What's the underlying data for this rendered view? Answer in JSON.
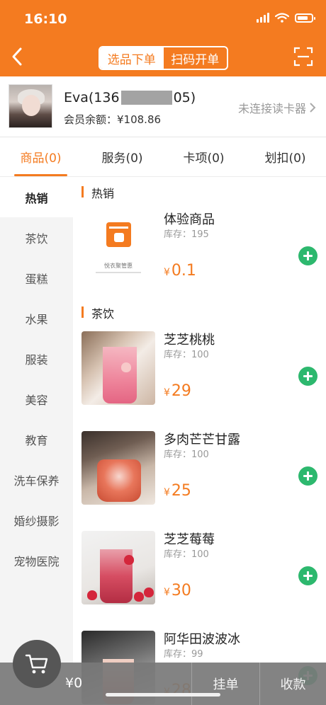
{
  "status_bar": {
    "time": "16:10"
  },
  "header": {
    "segments": [
      {
        "label": "选品下单",
        "active": true
      },
      {
        "label": "扫码开单",
        "active": false
      }
    ],
    "icons": {
      "back": "chevron-left-icon",
      "scan": "scan-icon"
    }
  },
  "member": {
    "name_prefix": "Eva(136",
    "name_suffix": "05)",
    "balance": "会员余额：¥108.86",
    "reader_status": "未连接读卡器"
  },
  "tabs": [
    {
      "label": "商品(0)",
      "active": true
    },
    {
      "label": "服务(0)",
      "active": false
    },
    {
      "label": "卡项(0)",
      "active": false
    },
    {
      "label": "划扣(0)",
      "active": false
    }
  ],
  "categories": [
    "热销",
    "茶饮",
    "蛋糕",
    "水果",
    "服装",
    "美容",
    "教育",
    "洗车保养",
    "婚纱摄影",
    "宠物医院"
  ],
  "sections": [
    {
      "title": "热销",
      "products": [
        {
          "name": "体验商品",
          "stock": "库存：195",
          "currency": "¥",
          "price": "0.1",
          "logo_text": "悦衣聚管惠"
        }
      ]
    },
    {
      "title": "茶饮",
      "products": [
        {
          "name": "芝芝桃桃",
          "stock": "库存：100",
          "currency": "¥",
          "price": "29"
        },
        {
          "name": "多肉芒芒甘露",
          "stock": "库存：100",
          "currency": "¥",
          "price": "25"
        },
        {
          "name": "芝芝莓莓",
          "stock": "库存：100",
          "currency": "¥",
          "price": "30"
        },
        {
          "name": "阿华田波波冰",
          "stock": "库存：99",
          "currency": "¥",
          "price": "28"
        }
      ]
    }
  ],
  "bottom_bar": {
    "total": "¥0",
    "hold_label": "挂单",
    "pay_label": "收款",
    "cart_icon": "cart-icon"
  },
  "colors": {
    "brand": "#F47B20",
    "add": "#2DB86E"
  }
}
